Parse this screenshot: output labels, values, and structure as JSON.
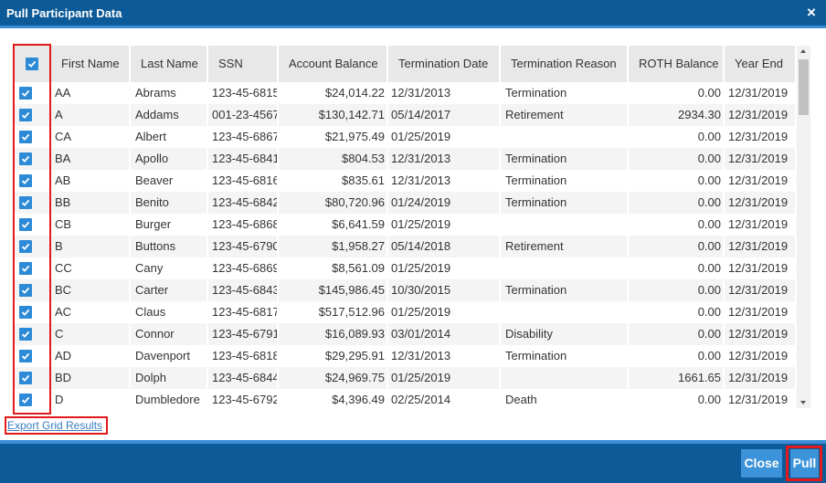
{
  "dialog": {
    "title": "Pull Participant Data",
    "close_label": "×"
  },
  "grid": {
    "select_all_checked": true,
    "columns": [
      "First Name",
      "Last Name",
      "SSN",
      "Account Balance",
      "Termination Date",
      "Termination Reason",
      "ROTH Balance",
      "Year End"
    ],
    "rows": [
      {
        "checked": true,
        "first_name": "AA",
        "last_name": "Abrams",
        "ssn": "123-45-6815",
        "account_balance": "$24,014.22",
        "termination_date": "12/31/2013",
        "termination_reason": "Termination",
        "roth_balance": "0.00",
        "year_end": "12/31/2019"
      },
      {
        "checked": true,
        "first_name": "A",
        "last_name": "Addams",
        "ssn": "001-23-4567",
        "account_balance": "$130,142.71",
        "termination_date": "05/14/2017",
        "termination_reason": "Retirement",
        "roth_balance": "2934.30",
        "year_end": "12/31/2019"
      },
      {
        "checked": true,
        "first_name": "CA",
        "last_name": "Albert",
        "ssn": "123-45-6867",
        "account_balance": "$21,975.49",
        "termination_date": "01/25/2019",
        "termination_reason": "",
        "roth_balance": "0.00",
        "year_end": "12/31/2019"
      },
      {
        "checked": true,
        "first_name": "BA",
        "last_name": "Apollo",
        "ssn": "123-45-6841",
        "account_balance": "$804.53",
        "termination_date": "12/31/2013",
        "termination_reason": "Termination",
        "roth_balance": "0.00",
        "year_end": "12/31/2019"
      },
      {
        "checked": true,
        "first_name": "AB",
        "last_name": "Beaver",
        "ssn": "123-45-6816",
        "account_balance": "$835.61",
        "termination_date": "12/31/2013",
        "termination_reason": "Termination",
        "roth_balance": "0.00",
        "year_end": "12/31/2019"
      },
      {
        "checked": true,
        "first_name": "BB",
        "last_name": "Benito",
        "ssn": "123-45-6842",
        "account_balance": "$80,720.96",
        "termination_date": "01/24/2019",
        "termination_reason": "Termination",
        "roth_balance": "0.00",
        "year_end": "12/31/2019"
      },
      {
        "checked": true,
        "first_name": "CB",
        "last_name": "Burger",
        "ssn": "123-45-6868",
        "account_balance": "$6,641.59",
        "termination_date": "01/25/2019",
        "termination_reason": "",
        "roth_balance": "0.00",
        "year_end": "12/31/2019"
      },
      {
        "checked": true,
        "first_name": "B",
        "last_name": "Buttons",
        "ssn": "123-45-6790",
        "account_balance": "$1,958.27",
        "termination_date": "05/14/2018",
        "termination_reason": "Retirement",
        "roth_balance": "0.00",
        "year_end": "12/31/2019"
      },
      {
        "checked": true,
        "first_name": "CC",
        "last_name": "Cany",
        "ssn": "123-45-6869",
        "account_balance": "$8,561.09",
        "termination_date": "01/25/2019",
        "termination_reason": "",
        "roth_balance": "0.00",
        "year_end": "12/31/2019"
      },
      {
        "checked": true,
        "first_name": "BC",
        "last_name": "Carter",
        "ssn": "123-45-6843",
        "account_balance": "$145,986.45",
        "termination_date": "10/30/2015",
        "termination_reason": "Termination",
        "roth_balance": "0.00",
        "year_end": "12/31/2019"
      },
      {
        "checked": true,
        "first_name": "AC",
        "last_name": "Claus",
        "ssn": "123-45-6817",
        "account_balance": "$517,512.96",
        "termination_date": "01/25/2019",
        "termination_reason": "",
        "roth_balance": "0.00",
        "year_end": "12/31/2019"
      },
      {
        "checked": true,
        "first_name": "C",
        "last_name": "Connor",
        "ssn": "123-45-6791",
        "account_balance": "$16,089.93",
        "termination_date": "03/01/2014",
        "termination_reason": "Disability",
        "roth_balance": "0.00",
        "year_end": "12/31/2019"
      },
      {
        "checked": true,
        "first_name": "AD",
        "last_name": "Davenport",
        "ssn": "123-45-6818",
        "account_balance": "$29,295.91",
        "termination_date": "12/31/2013",
        "termination_reason": "Termination",
        "roth_balance": "0.00",
        "year_end": "12/31/2019"
      },
      {
        "checked": true,
        "first_name": "BD",
        "last_name": "Dolph",
        "ssn": "123-45-6844",
        "account_balance": "$24,969.75",
        "termination_date": "01/25/2019",
        "termination_reason": "",
        "roth_balance": "1661.65",
        "year_end": "12/31/2019"
      },
      {
        "checked": true,
        "first_name": "D",
        "last_name": "Dumbledore",
        "ssn": "123-45-6792",
        "account_balance": "$4,396.49",
        "termination_date": "02/25/2014",
        "termination_reason": "Death",
        "roth_balance": "0.00",
        "year_end": "12/31/2019"
      }
    ]
  },
  "export_link": {
    "label": "Export Grid Results"
  },
  "footer": {
    "close_label": "Close",
    "pull_label": "Pull"
  },
  "icons": {
    "close": "close-icon",
    "checkbox": "check-icon",
    "scroll_up": "scroll-up-icon",
    "scroll_down": "scroll-down-icon"
  },
  "colors": {
    "header": "#0c5a97",
    "strip": "#3b8ed6",
    "accent": "#2d8ad6",
    "button": "#3c93d9",
    "highlight": "#e3191b",
    "link": "#3a7dc2"
  }
}
